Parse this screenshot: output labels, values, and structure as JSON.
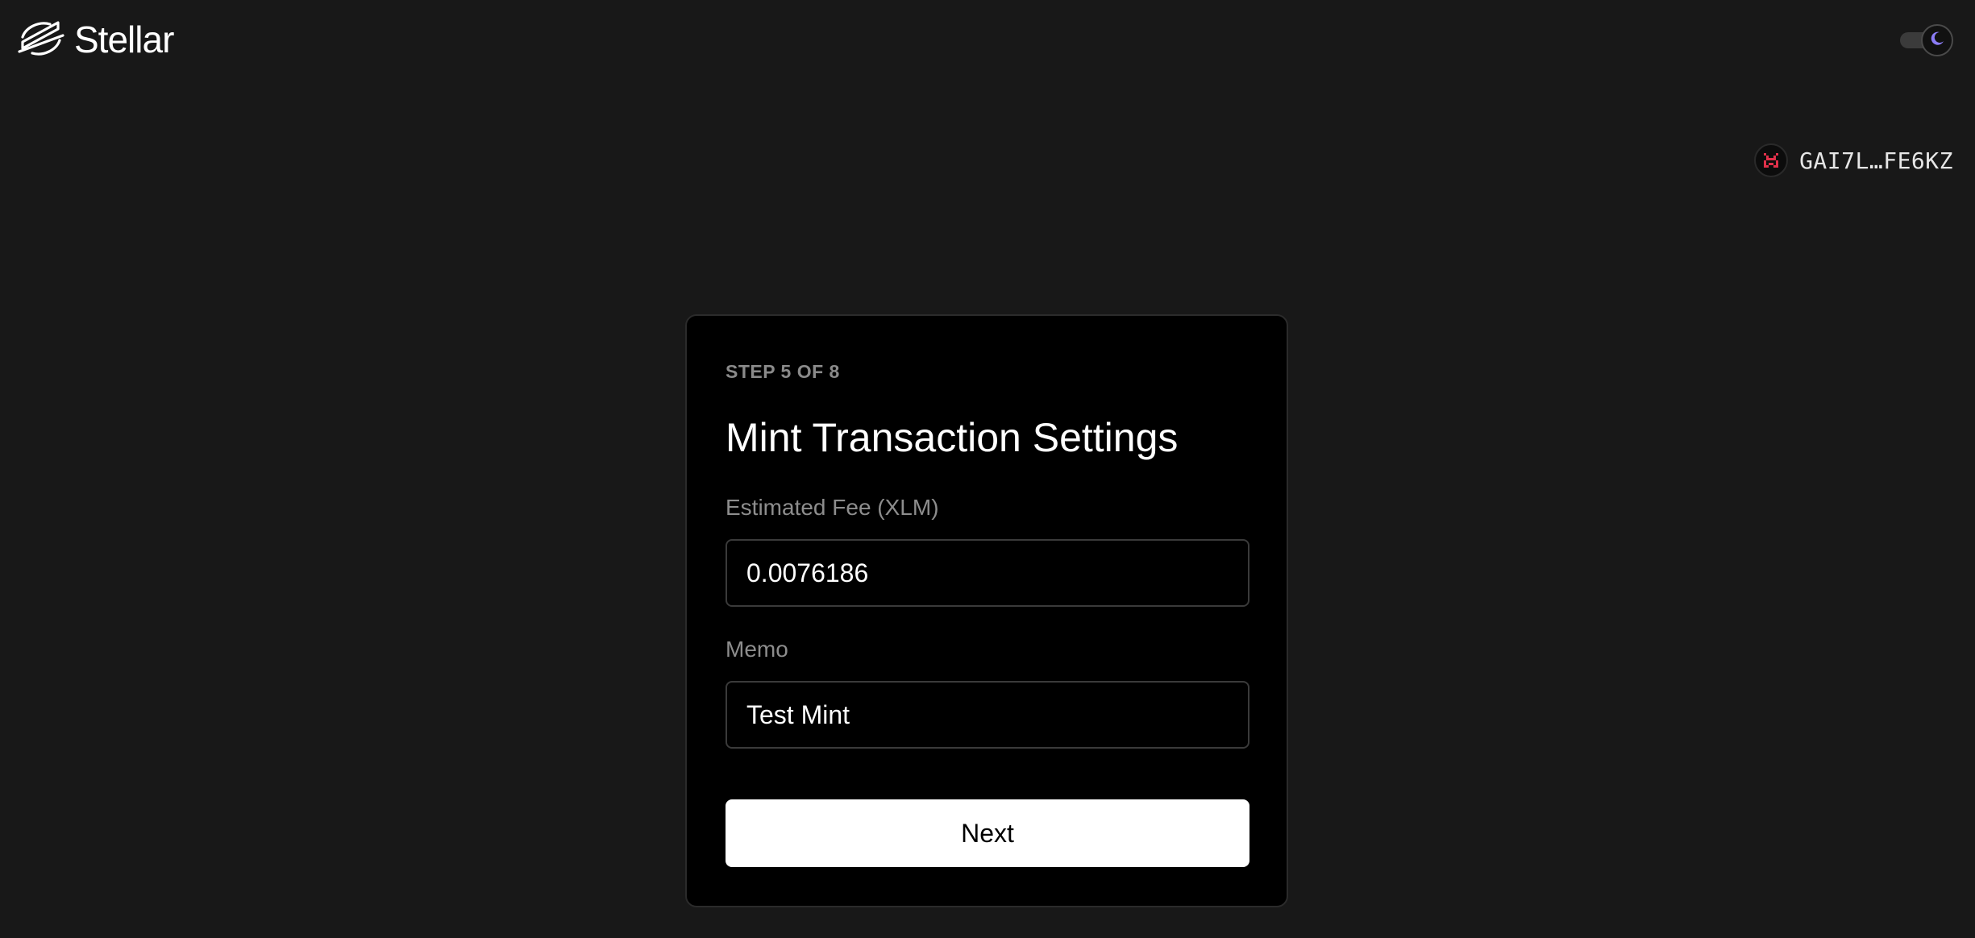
{
  "header": {
    "logo_text": "Stellar",
    "logo_icon": "stellar-logo-icon",
    "theme_toggle_icon": "moon-icon"
  },
  "account": {
    "avatar_icon": "identicon-avatar",
    "address": "GAI7L…FE6KZ"
  },
  "card": {
    "step": "STEP 5 OF 8",
    "title": "Mint Transaction Settings",
    "fee_label": "Estimated Fee (XLM)",
    "fee_value": "0.0076186",
    "memo_label": "Memo",
    "memo_value": "Test Mint",
    "next_label": "Next"
  },
  "colors": {
    "background": "#181818",
    "card_background": "#000000",
    "accent": "#8b7cf6",
    "avatar_accent": "#e0304a"
  }
}
